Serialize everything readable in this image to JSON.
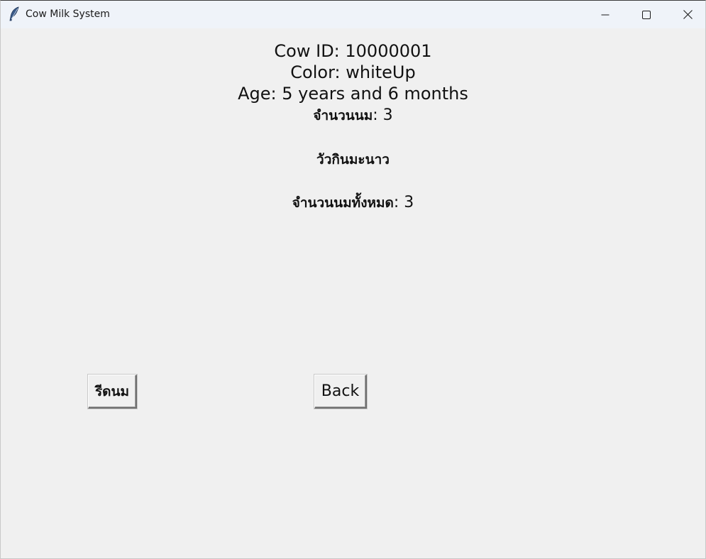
{
  "window": {
    "title": "Cow Milk System",
    "app_icon": "feather-icon",
    "controls": {
      "minimize_icon": "minimize-icon",
      "maximize_icon": "maximize-icon",
      "close_icon": "close-icon"
    }
  },
  "cow": {
    "id_line": "Cow ID: 10000001",
    "color_line": "Color: whiteUp",
    "age_line": "Age: 5 years and 6 months",
    "milk_label": "จำนวนนม",
    "milk_value": ": 3",
    "status": "วัวกินมะนาว",
    "total_label": "จำนวนนมทั้งหมด",
    "total_value": ": 3"
  },
  "buttons": {
    "milk_label": "รีดนม",
    "back_label": "Back"
  }
}
